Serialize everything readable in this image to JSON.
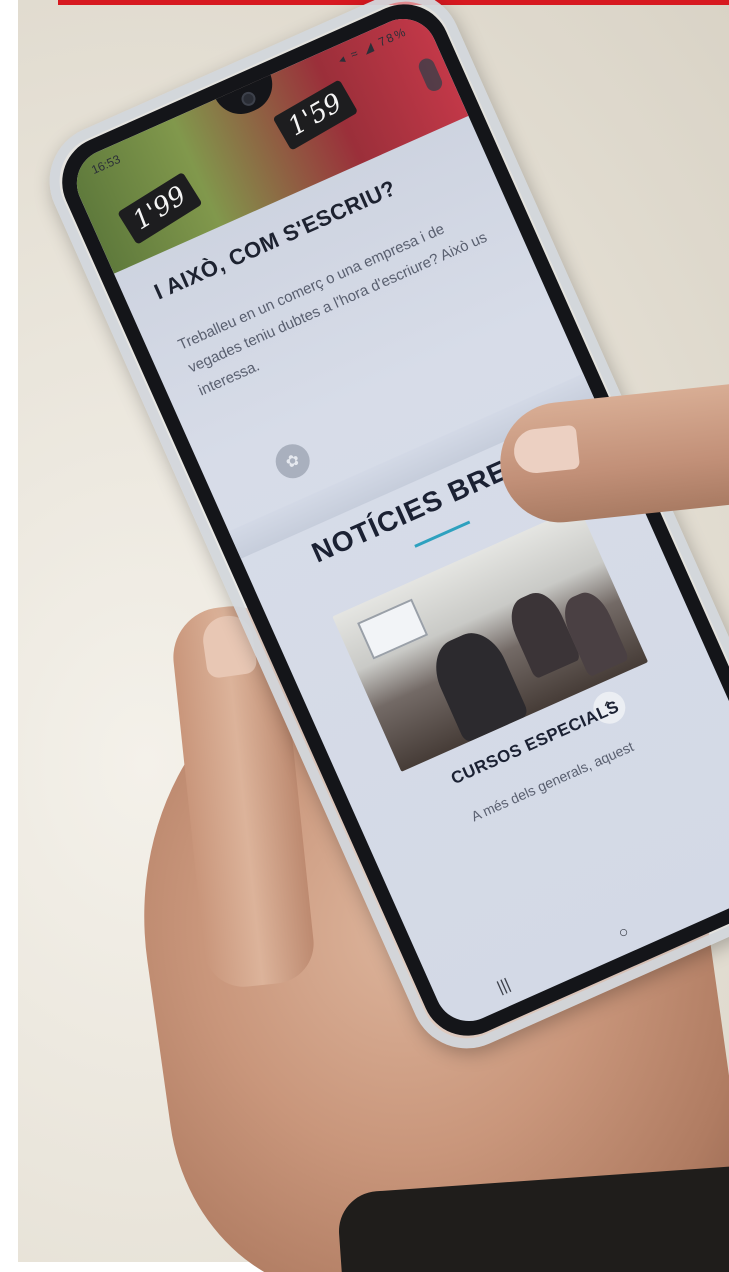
{
  "colors": {
    "accent_underline": "#2ea1bf",
    "top_bar": "#d71920"
  },
  "status_bar": {
    "time": "16:53",
    "battery": "78%"
  },
  "hero": {
    "price_left": "1'99",
    "price_right": "1'59"
  },
  "section": {
    "title": "I AIXÒ, COM S'ESCRIU?",
    "body": "Treballeu en un comerç o una empresa i de vegades teniu dubtes a l'hora d'escriure? Això us interessa."
  },
  "news": {
    "title": "NOTÍCIES BREUS",
    "article_title": "CURSOS ESPECIALS",
    "article_excerpt": "A més dels generals, aquest"
  },
  "icons": {
    "share": "share-icon",
    "scroll_top": "chevron-up-icon",
    "nav_recents": "recents-icon",
    "nav_home": "home-icon",
    "nav_back": "back-icon"
  }
}
